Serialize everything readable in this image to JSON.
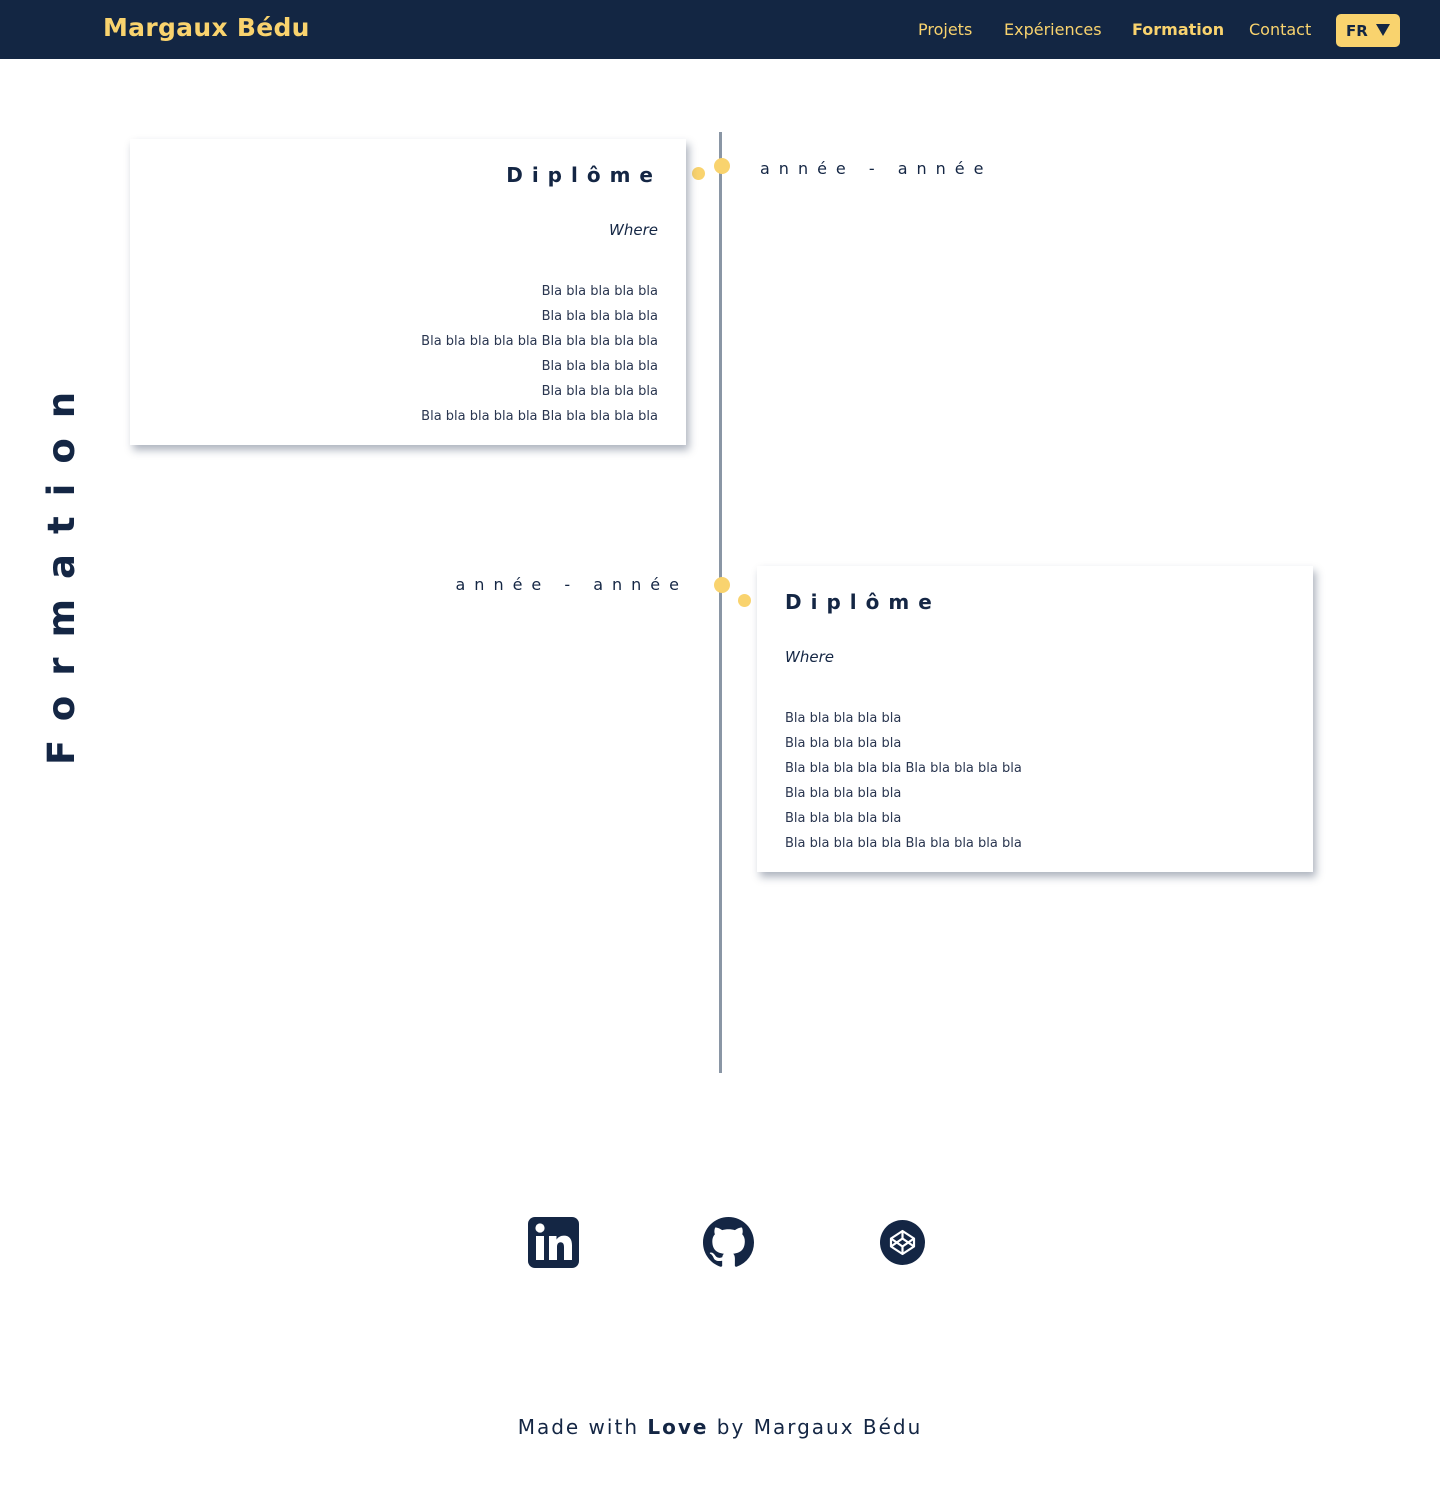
{
  "header": {
    "brand": "Margaux Bédu",
    "nav": [
      {
        "label": "Projets",
        "active": false
      },
      {
        "label": "Expériences",
        "active": false
      },
      {
        "label": "Formation",
        "active": true
      },
      {
        "label": "Contact",
        "active": false
      }
    ],
    "language": {
      "selected": "FR",
      "icon": "caret-down-icon"
    }
  },
  "section": {
    "title": "Formation"
  },
  "timeline": [
    {
      "side": "left",
      "title": "Diplôme",
      "where": "Where",
      "date": "année - année",
      "lines": [
        "Bla bla bla bla bla",
        "Bla bla bla bla bla",
        "Bla bla bla bla bla Bla bla bla bla bla",
        "Bla bla bla bla bla",
        "Bla bla bla bla bla",
        "Bla bla bla bla bla Bla bla bla bla bla"
      ]
    },
    {
      "side": "right",
      "title": "Diplôme",
      "where": "Where",
      "date": "année - année",
      "lines": [
        "Bla bla bla bla bla",
        "Bla bla bla bla bla",
        "Bla bla bla bla bla Bla bla bla bla bla",
        "Bla bla bla bla bla",
        "Bla bla bla bla bla",
        "Bla bla bla bla bla Bla bla bla bla bla"
      ]
    }
  ],
  "social": [
    {
      "name": "LinkedIn",
      "icon": "linkedin-icon"
    },
    {
      "name": "GitHub",
      "icon": "github-icon"
    },
    {
      "name": "CodePen",
      "icon": "codepen-icon"
    }
  ],
  "footer": {
    "prefix": "Made with ",
    "emphasis": "Love",
    "suffix": " by Margaux Bédu"
  },
  "colors": {
    "navy": "#132643",
    "accent": "#f9d36e",
    "line": "#8a96a5"
  }
}
